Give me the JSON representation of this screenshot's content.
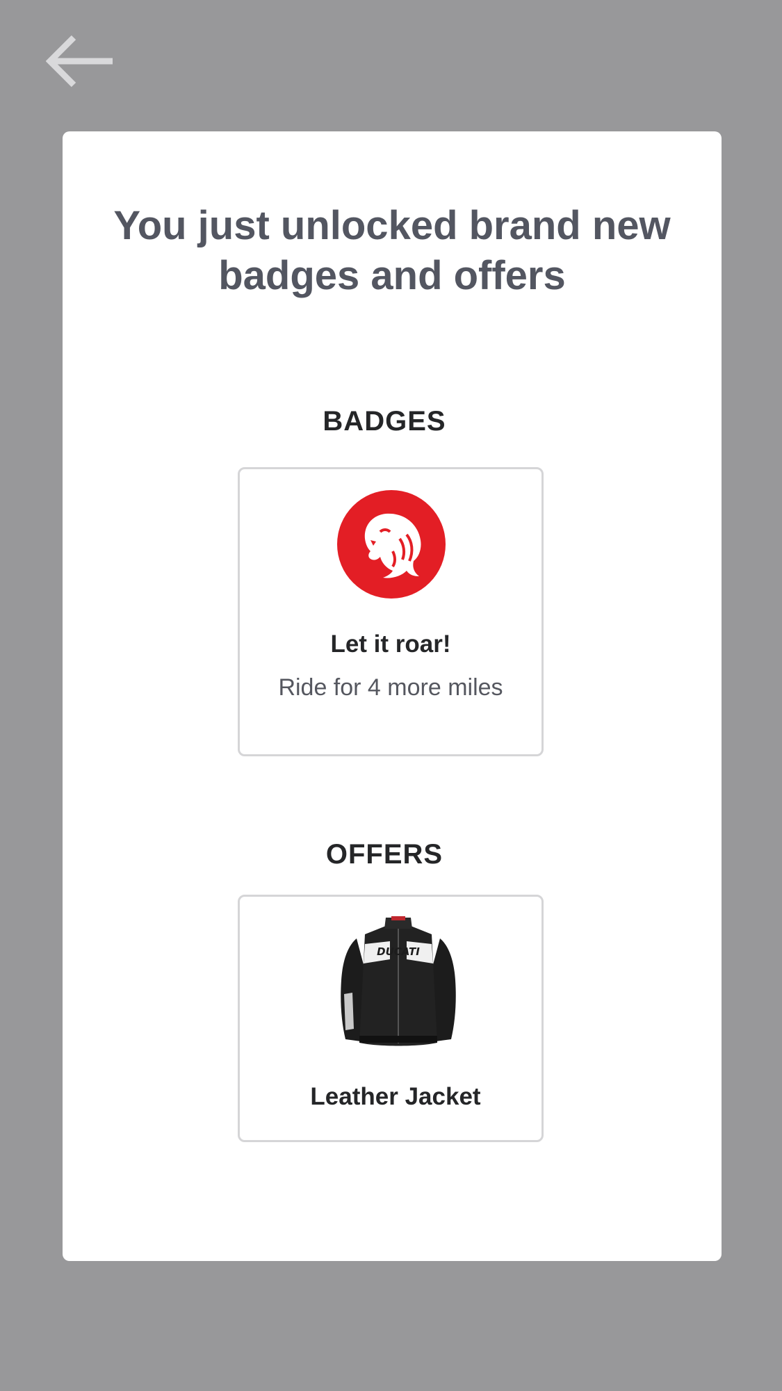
{
  "header": {
    "back_icon": "arrow-left-icon"
  },
  "card": {
    "headline": "You just unlocked brand new badges and offers"
  },
  "badges": {
    "section_title": "BADGES",
    "items": [
      {
        "icon": "lion-icon",
        "icon_color": "#e31e25",
        "name": "Let it roar!",
        "description": "Ride for 4 more miles"
      }
    ]
  },
  "offers": {
    "section_title": "OFFERS",
    "items": [
      {
        "image": "leather-jacket-image",
        "brand_text": "DUCATI",
        "name": "Leather Jacket"
      }
    ]
  },
  "colors": {
    "background": "#98989a",
    "card": "#ffffff",
    "headline": "#535661",
    "accent_red": "#e31e25"
  }
}
